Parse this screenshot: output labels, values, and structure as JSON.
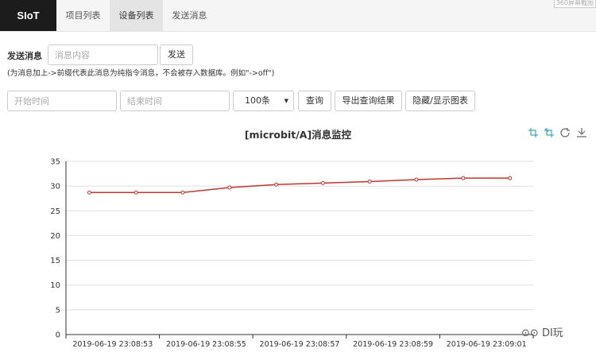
{
  "nav": {
    "brand": "SIoT",
    "items": [
      {
        "label": "项目列表",
        "active": false
      },
      {
        "label": "设备列表",
        "active": true
      },
      {
        "label": "发送消息",
        "active": false
      }
    ],
    "badge": "360屏幕截图"
  },
  "send": {
    "label": "发送消息",
    "input_placeholder": "消息内容",
    "button": "发送",
    "hint": "(为消息加上->前缀代表此消息为纯指令消息，不会被存入数据库。例如\"->off\")"
  },
  "query": {
    "start_placeholder": "开始时间",
    "end_placeholder": "结束时间",
    "limit_value": "100条",
    "query_button": "查询",
    "export_button": "导出查询结果",
    "toggle_button": "隐藏/显示图表"
  },
  "toolbox": [
    "zoom-icon",
    "zoom-reset-icon",
    "restore-icon",
    "download-icon"
  ],
  "watermark": "DI玩",
  "chart_data": {
    "type": "line",
    "title": "[microbit/A]消息监控",
    "xlabel": "",
    "ylabel": "",
    "ylim": [
      0,
      35
    ],
    "yticks": [
      0,
      5,
      10,
      15,
      20,
      25,
      30,
      35
    ],
    "grid": true,
    "x_tick_labels": [
      "2019-06-19 23:08:53",
      "2019-06-19 23:08:55",
      "2019-06-19 23:08:57",
      "2019-06-19 23:08:59",
      "2019-06-19 23:09:01"
    ],
    "series": [
      {
        "color": "#c23531",
        "values": [
          28.7,
          28.7,
          28.7,
          29.7,
          30.3,
          30.6,
          30.9,
          31.3,
          31.6,
          31.6
        ]
      }
    ]
  }
}
